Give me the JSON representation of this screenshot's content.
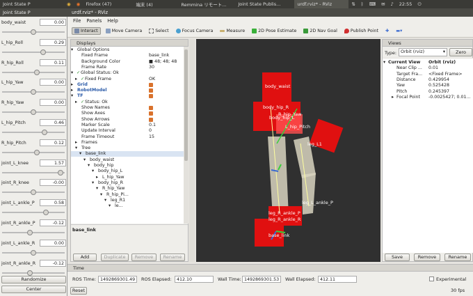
{
  "topbar": {
    "app_title": "Joint State P",
    "tabs": [
      "Firefox (47)",
      "端末 (4)",
      "Remmina リモート...",
      "Joint State Publis...",
      "urdf.rviz* - RViz"
    ],
    "clock": "22:55"
  },
  "joint_panel": {
    "joints": [
      {
        "name": "body_waist",
        "value": "0.00",
        "level": 0.5
      },
      {
        "name": "L_hip_Roll",
        "value": "0.29",
        "level": 0.65
      },
      {
        "name": "R_hip_Roll",
        "value": "0.11",
        "level": 0.55
      },
      {
        "name": "L_hip_Yaw",
        "value": "0.00",
        "level": 0.5
      },
      {
        "name": "R_hip_Yaw",
        "value": "0.00",
        "level": 0.5
      },
      {
        "name": "L_hip_Pitch",
        "value": "0.46",
        "level": 0.68
      },
      {
        "name": "R_hip_Pitch",
        "value": "0.12",
        "level": 0.56
      },
      {
        "name": "joint_L_knee",
        "value": "1.57",
        "level": 0.93
      },
      {
        "name": "joint_R_knee",
        "value": "-0.00",
        "level": 0.5
      },
      {
        "name": "joint_L_ankle_P",
        "value": "0.58",
        "level": 0.7
      },
      {
        "name": "joint_R_ankle_P",
        "value": "-0.12",
        "level": 0.44
      },
      {
        "name": "joint_L_ankle_R",
        "value": "0.00",
        "level": 0.5
      },
      {
        "name": "joint_R_ankle_R",
        "value": "-0.12",
        "level": 0.44
      }
    ],
    "randomize": "Randomize",
    "center": "Center"
  },
  "rviz": {
    "title": "urdf.rviz* - RViz",
    "menu": [
      "File",
      "Panels",
      "Help"
    ],
    "tools": [
      "Interact",
      "Move Camera",
      "Select",
      "Focus Camera",
      "Measure",
      "2D Pose Estimate",
      "2D Nav Goal",
      "Publish Point"
    ]
  },
  "displays": {
    "title": "Displays",
    "rows": [
      {
        "k": "Global Options",
        "v": "",
        "i": 1,
        "t": "▾"
      },
      {
        "k": "Fixed Frame",
        "v": "base_link",
        "i": 2
      },
      {
        "k": "Background Color",
        "v": "■ 48; 48; 48",
        "i": 2
      },
      {
        "k": "Frame Rate",
        "v": "30",
        "i": 2
      },
      {
        "k": "Global Status: Ok",
        "v": "",
        "i": 1,
        "t": "▾ ✓"
      },
      {
        "k": "Fixed Frame",
        "v": "OK",
        "i": 2,
        "t": "✓"
      },
      {
        "k": "Grid",
        "v": "",
        "i": 1,
        "t": "▸",
        "cb": true,
        "blue": true
      },
      {
        "k": "RobotModel",
        "v": "",
        "i": 1,
        "t": "▸",
        "cb": true,
        "blue": true
      },
      {
        "k": "TF",
        "v": "",
        "i": 1,
        "t": "▾",
        "cb": true,
        "blue": true
      },
      {
        "k": "Status: Ok",
        "v": "",
        "i": 2,
        "t": "▸ ✓"
      },
      {
        "k": "Show Names",
        "v": "",
        "i": 2,
        "cb": true
      },
      {
        "k": "Show Axes",
        "v": "",
        "i": 2,
        "cb": true
      },
      {
        "k": "Show Arrows",
        "v": "",
        "i": 2,
        "cb": true
      },
      {
        "k": "Marker Scale",
        "v": "0.1",
        "i": 2
      },
      {
        "k": "Update Interval",
        "v": "0",
        "i": 2
      },
      {
        "k": "Frame Timeout",
        "v": "15",
        "i": 2
      },
      {
        "k": "Frames",
        "v": "",
        "i": 2,
        "t": "▸"
      },
      {
        "k": "Tree",
        "v": "",
        "i": 2,
        "t": "▾"
      },
      {
        "k": "base_link",
        "v": "",
        "i": 3,
        "t": "▾",
        "sel": true
      },
      {
        "k": "body_waist",
        "v": "",
        "i": 4,
        "t": "▾"
      },
      {
        "k": "body_hip",
        "v": "",
        "i": 5,
        "t": "▾"
      },
      {
        "k": "body_hip_L",
        "v": "",
        "i": 6,
        "t": "▾"
      },
      {
        "k": "L_hip_Yaw",
        "v": "",
        "i": 7,
        "t": "▸"
      },
      {
        "k": "body_hip_R",
        "v": "",
        "i": 6,
        "t": "▾"
      },
      {
        "k": "R_hip_Yaw",
        "v": "",
        "i": 7,
        "t": "▾"
      },
      {
        "k": "R_hip_Pi...",
        "v": "",
        "i": 8,
        "t": "▾"
      },
      {
        "k": "leg_R1",
        "v": "",
        "i": 9,
        "t": "▾"
      },
      {
        "k": "le...",
        "v": "",
        "i": 10,
        "t": "▾"
      }
    ],
    "description": "base_link",
    "buttons": [
      "Add",
      "Duplicate",
      "Remove",
      "Rename"
    ]
  },
  "scene_labels": [
    "body_waist",
    "body_hip_R",
    "R_hip_Yaw",
    "body_hip_L",
    "L_hip_Pitch",
    "leg_L1",
    "leg_L_ankle_P",
    "leg_R_ankle_P",
    "leg_R_ankle_R",
    "base_link"
  ],
  "views": {
    "title": "Views",
    "type_label": "Type:",
    "type_value": "Orbit (rviz)",
    "zero": "Zero",
    "rows": [
      {
        "k": "Current View",
        "v": "Orbit (rviz)",
        "i": 0,
        "t": "▾"
      },
      {
        "k": "Near Clip ...",
        "v": "0.01",
        "i": 1
      },
      {
        "k": "Target Fra...",
        "v": "<Fixed Frame>",
        "i": 1
      },
      {
        "k": "Distance",
        "v": "0.429954",
        "i": 1
      },
      {
        "k": "Yaw",
        "v": "0.525428",
        "i": 1
      },
      {
        "k": "Pitch",
        "v": "0.245397",
        "i": 1
      },
      {
        "k": "Focal Point",
        "v": "-0.0025427; 0.01...",
        "i": 1,
        "t": "▸"
      }
    ],
    "buttons": [
      "Save",
      "Remove",
      "Rename"
    ]
  },
  "time": {
    "title": "Time",
    "ros_time_label": "ROS Time:",
    "ros_time": "1492869301.49",
    "ros_elapsed_label": "ROS Elapsed:",
    "ros_elapsed": "412.10",
    "wall_time_label": "Wall Time:",
    "wall_time": "1492869301.53",
    "wall_elapsed_label": "Wall Elapsed:",
    "wall_elapsed": "412.11",
    "experimental": "Experimental",
    "reset": "Reset",
    "fps": "30 fps"
  },
  "colors": {
    "link": "#e01010",
    "accent": "#d9722c",
    "viewport_bg": "#303030"
  }
}
